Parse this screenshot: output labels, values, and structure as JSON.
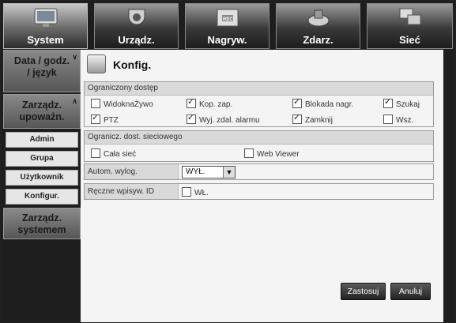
{
  "tabs": [
    {
      "label": "System",
      "icon": "monitor-icon",
      "active": true
    },
    {
      "label": "Urządz.",
      "icon": "camera-icon",
      "active": false
    },
    {
      "label": "Nagryw.",
      "icon": "rec-icon",
      "active": false
    },
    {
      "label": "Zdarz.",
      "icon": "event-icon",
      "active": false
    },
    {
      "label": "Sieć",
      "icon": "network-icon",
      "active": false
    }
  ],
  "sidebar": {
    "date_group": "Data / godz. / język",
    "perm_group": "Zarządz. upoważn.",
    "items": [
      "Admin",
      "Grupa",
      "Użytkownik",
      "Konfigur."
    ],
    "sys_group": "Zarządz. systemem"
  },
  "page": {
    "title": "Konfig."
  },
  "restricted": {
    "header": "Ograniczony dostęp",
    "options": [
      {
        "label": "WidoknaŻywo",
        "checked": false
      },
      {
        "label": "Kop. zap.",
        "checked": true
      },
      {
        "label": "Blokada nagr.",
        "checked": true
      },
      {
        "label": "Szukaj",
        "checked": true
      },
      {
        "label": "PTZ",
        "checked": true
      },
      {
        "label": "Wyj. zdal. alarmu",
        "checked": true
      },
      {
        "label": "Zamknij",
        "checked": true
      },
      {
        "label": "Wsz.",
        "checked": false
      }
    ]
  },
  "network": {
    "header": "Ogranicz. dost. sieciowego",
    "options": [
      {
        "label": "Cała sieć",
        "checked": false
      },
      {
        "label": "Web Viewer",
        "checked": false
      }
    ]
  },
  "autologout": {
    "label": "Autom. wylog.",
    "value": "WYŁ."
  },
  "manual_id": {
    "label": "Ręczne wpisyw. ID",
    "option": "WŁ.",
    "checked": false
  },
  "buttons": {
    "apply": "Zastosuj",
    "cancel": "Anuluj"
  }
}
